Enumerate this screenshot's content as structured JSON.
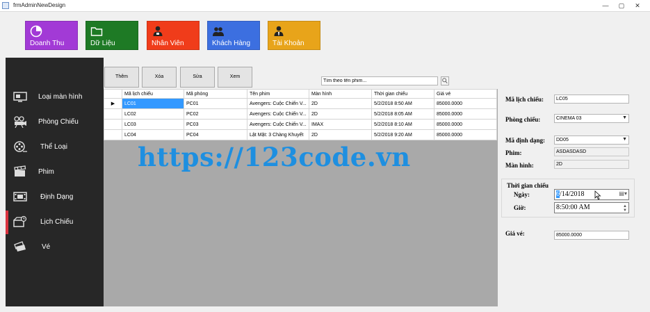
{
  "window": {
    "title": "frmAdminNewDesign",
    "minimize": "—",
    "maximize": "▢",
    "close": "✕"
  },
  "tiles": [
    {
      "label": "Doanh Thu",
      "color": "#a23ad6",
      "icon": "chart-pie-icon"
    },
    {
      "label": "Dữ Liệu",
      "color": "#1e7a25",
      "icon": "folder-icon"
    },
    {
      "label": "Nhân Viên",
      "color": "#f03c1a",
      "icon": "employee-icon"
    },
    {
      "label": "Khách Hàng",
      "color": "#3c6fe0",
      "icon": "customers-icon"
    },
    {
      "label": "Tài Khoản",
      "color": "#e8a41a",
      "icon": "account-icon"
    }
  ],
  "sidebar": {
    "items": [
      {
        "label": "Loại màn hình",
        "icon": "monitor-icon"
      },
      {
        "label": "Phòng Chiếu",
        "icon": "projector-icon"
      },
      {
        "label": "Thể Loại",
        "icon": "film-reel-icon"
      },
      {
        "label": "Phim",
        "icon": "clapperboard-icon"
      },
      {
        "label": "Định Dạng",
        "icon": "film-strip-icon"
      },
      {
        "label": "Lịch Chiếu",
        "icon": "schedule-icon"
      },
      {
        "label": "Vé",
        "icon": "ticket-icon"
      }
    ],
    "active_index": 5
  },
  "toolbar": {
    "add_label": "Thêm",
    "delete_label": "Xóa",
    "edit_label": "Sửa",
    "view_label": "Xem",
    "search_value": "Tìm theo tên phim..."
  },
  "grid": {
    "columns": [
      "Mã lịch chiếu",
      "Mã phòng",
      "Tên phim",
      "Màn hình",
      "Thời gian chiếu",
      "Giá vé"
    ],
    "rows": [
      [
        "LC01",
        "PC01",
        "Avengers: Cuộc Chiến V...",
        "2D",
        "5/2/2018 8:50 AM",
        "85000.0000"
      ],
      [
        "LC02",
        "PC02",
        "Avengers: Cuộc Chiến V...",
        "2D",
        "5/2/2018 8:05 AM",
        "85000.0000"
      ],
      [
        "LC03",
        "PC03",
        "Avengers: Cuộc Chiến V...",
        "IMAX",
        "5/2/2018 8:10 AM",
        "85000.0000"
      ],
      [
        "LC04",
        "PC04",
        "Lật Mặt: 3 Chàng Khuyết",
        "2D",
        "5/2/2018 9:20 AM",
        "85000.0000"
      ]
    ],
    "selected_row": 0,
    "row_indicator": "▶"
  },
  "form": {
    "ma_lich_chieu_label": "Mã lịch chiếu:",
    "ma_lich_chieu_value": "LC05",
    "phong_chieu_label": "Phòng chiếu:",
    "phong_chieu_value": "CINEMA 03",
    "ma_dinh_dang_label": "Mã định dạng:",
    "ma_dinh_dang_value": "DD05",
    "phim_label": "Phim:",
    "phim_value": "ASDASDASD",
    "man_hinh_label": "Màn hình:",
    "man_hinh_value": "2D",
    "group_title": "Thời gian chiếu",
    "ngay_label": "Ngày:",
    "ngay_month": "6",
    "ngay_rest": "/14/2018",
    "gio_label": "Giờ:",
    "gio_value": "8:50:00 AM",
    "gia_ve_label": "Giá vé:",
    "gia_ve_value": "85000.0000"
  },
  "watermark": "https://123code.vn"
}
